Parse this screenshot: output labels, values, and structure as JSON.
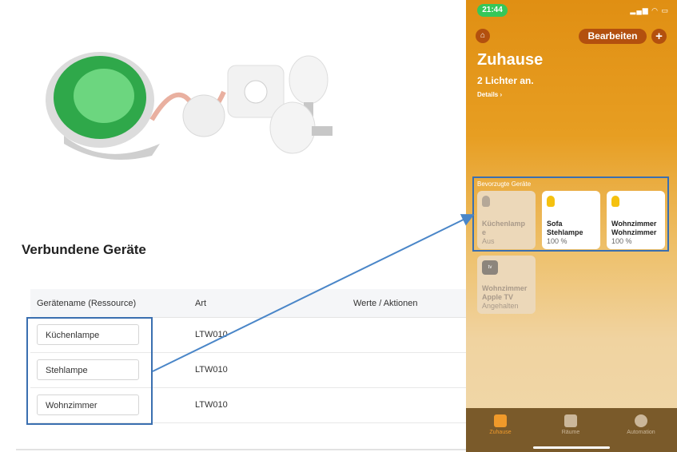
{
  "connected_devices": {
    "title": "Verbundene Geräte",
    "columns": [
      "Gerätename (Ressource)",
      "Art",
      "Werte / Aktionen"
    ],
    "rows": [
      {
        "name": "Küchenlampe",
        "art": "LTW010"
      },
      {
        "name": "Stehlampe",
        "art": "LTW010"
      },
      {
        "name": "Wohnzimmer",
        "art": "LTW010"
      }
    ]
  },
  "phone": {
    "status_time": "21:44",
    "edit_label": "Bearbeiten",
    "home_title": "Zuhause",
    "home_subtitle": "2 Lichter an.",
    "details_label": "Details ›",
    "favorites_label": "Bevorzugte Geräte",
    "tiles": [
      {
        "name": "Küchenlamp e",
        "status": "Aus",
        "state": "off"
      },
      {
        "name": "Sofa Stehlampe",
        "status": "100 %",
        "state": "on"
      },
      {
        "name": "Wohnzimmer Wohnzimmer",
        "status": "100 %",
        "state": "on"
      },
      {
        "name": "Wohnzimmer Apple TV",
        "status": "Angehalten",
        "state": "off"
      }
    ],
    "appletv_icon_label": "tv",
    "tabs": [
      {
        "label": "Zuhause",
        "active": true
      },
      {
        "label": "Räume",
        "active": false
      },
      {
        "label": "Automation",
        "active": false
      }
    ]
  },
  "colors": {
    "accent_blue": "#3a6fb0",
    "home_orange": "#e08f13",
    "bulb_on": "#f5c10f"
  }
}
